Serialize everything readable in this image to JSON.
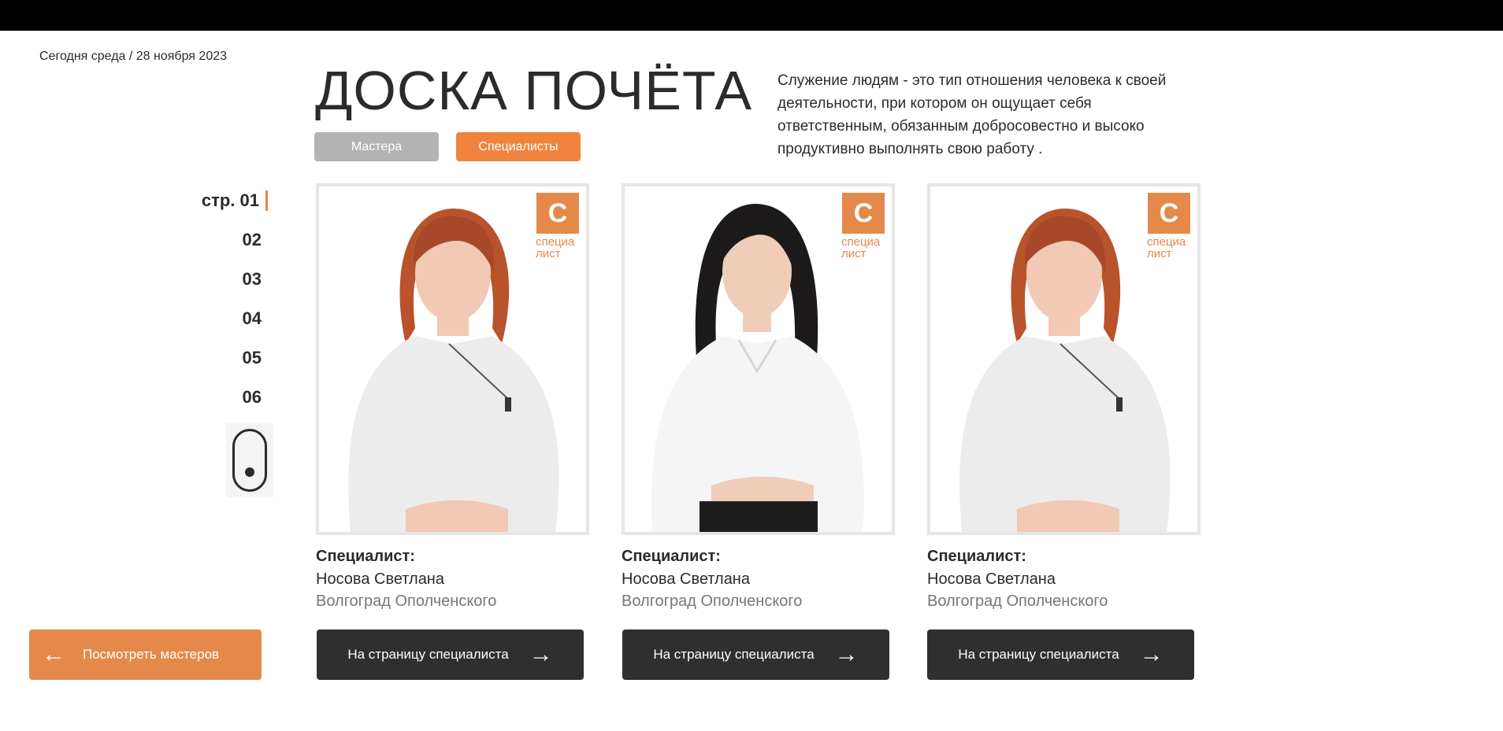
{
  "header": {
    "date_text": "Сегодня среда / 28 ноября 2023",
    "title": "ДОСКА ПОЧЁТА",
    "quote": "Служение людям - это тип отношения человека к своей деятельности, при котором он ощущает себя ответственным, обязанным добросовестно и высоко продуктивно выполнять свою работу ."
  },
  "tabs": {
    "masters": "Мастера",
    "specialists": "Специалисты",
    "active": "specialists"
  },
  "pager": {
    "active_label": "стр. 01",
    "pages": [
      "02",
      "03",
      "04",
      "05",
      "06"
    ]
  },
  "badge": {
    "letter": "С",
    "caption_line1": "специа",
    "caption_line2": "лист"
  },
  "cards": [
    {
      "role": "Специалист:",
      "name": "Носова Светлана",
      "city": "Волгоград Ополченского",
      "button": "На страницу специалиста",
      "photo": "woman-red-hair"
    },
    {
      "role": "Специалист:",
      "name": "Носова Светлана",
      "city": "Волгоград Ополченского",
      "button": "На страницу специалиста",
      "photo": "woman-dark-hair"
    },
    {
      "role": "Специалист:",
      "name": "Носова Светлана",
      "city": "Волгоград Ополченского",
      "button": "На страницу специалиста",
      "photo": "woman-red-hair"
    }
  ],
  "back_button": "Посмотреть мастеров",
  "colors": {
    "accent": "#f0843f",
    "dark_button": "#2f2f2f",
    "inactive_tab": "#b3b3b3"
  }
}
